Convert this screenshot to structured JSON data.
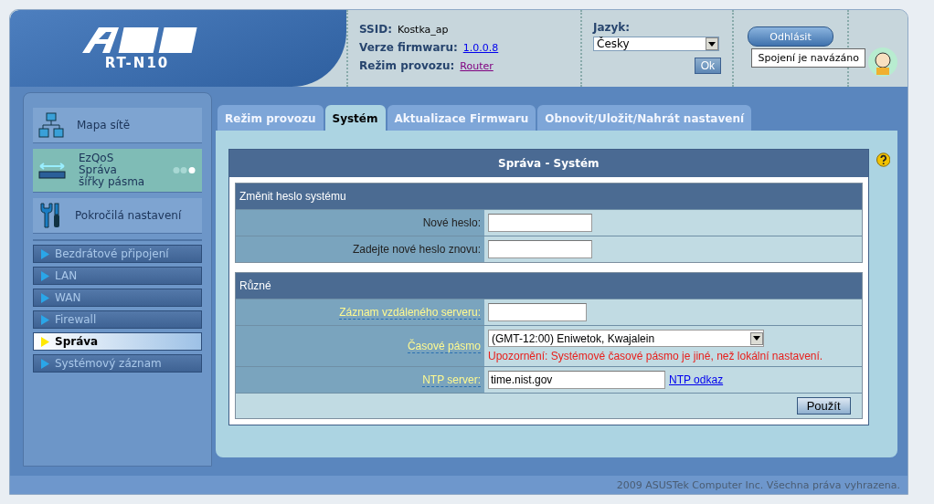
{
  "header": {
    "model": "RT-N10",
    "info": [
      {
        "label": "SSID:",
        "value": "Kostka_ap",
        "kind": "text"
      },
      {
        "label": "Verze firmwaru:",
        "value": "1.0.0.8",
        "kind": "link"
      },
      {
        "label": "Režim provozu:",
        "value": "Router",
        "kind": "visited"
      }
    ],
    "language": {
      "label": "Jazyk:",
      "value": "Česky",
      "button": "Ok"
    },
    "logout": "Odhlásit",
    "tooltip": "Spojení je navázáno"
  },
  "sidebar": {
    "sections": [
      {
        "label": "Mapa sítě",
        "kind": "map"
      },
      {
        "label": "EzQoS\nSpráva\nšířky pásma",
        "kind": "qos"
      },
      {
        "label": "Pokročilá nastavení",
        "kind": "tools"
      }
    ],
    "items": [
      {
        "label": "Bezdrátové připojení",
        "selected": false
      },
      {
        "label": "LAN",
        "selected": false
      },
      {
        "label": "WAN",
        "selected": false
      },
      {
        "label": "Firewall",
        "selected": false
      },
      {
        "label": "Správa",
        "selected": true
      },
      {
        "label": "Systémový záznam",
        "selected": false
      }
    ]
  },
  "tabs": [
    {
      "label": "Režim provozu",
      "selected": false
    },
    {
      "label": "Systém",
      "selected": true
    },
    {
      "label": "Aktualizace Firmwaru",
      "selected": false
    },
    {
      "label": "Obnovit/Uložit/Nahrát nastavení",
      "selected": false
    }
  ],
  "panel": {
    "title": "Správa - Systém",
    "sections": [
      {
        "title": "Změnit heslo systému",
        "rows": [
          {
            "label": "Nové heslo:",
            "kind": "password",
            "hint": false
          },
          {
            "label": "Zadejte nové heslo znovu:",
            "kind": "password",
            "hint": false
          }
        ]
      },
      {
        "title": "Různé",
        "rows": [
          {
            "label": "Záznam vzdáleného serveru:",
            "kind": "short",
            "hint": true
          },
          {
            "label": "Časové pásmo",
            "kind": "select",
            "hint": true,
            "value": "(GMT-12:00) Eniwetok, Kwajalein",
            "warning": "Upozornění: Systémové časové pásmo je jiné, než lokální nastavení."
          },
          {
            "label": "NTP server:",
            "kind": "text",
            "hint": true,
            "value": "time.nist.gov",
            "link": "NTP odkaz"
          }
        ]
      }
    ],
    "button": "Použít"
  },
  "footer": "2009 ASUSTek Computer Inc. Všechna práva vyhrazena."
}
